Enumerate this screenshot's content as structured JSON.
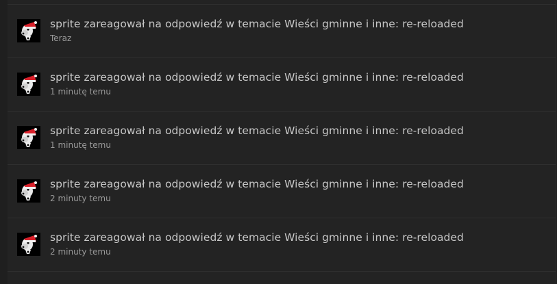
{
  "notifications": [
    {
      "user": "sprite",
      "text": "sprite zareagował na odpowiedź w temacie Wieści gminne i inne: re-reloaded",
      "time": "Teraz",
      "avatar_icon": "santa-hat-dog-avatar"
    },
    {
      "user": "sprite",
      "text": "sprite zareagował na odpowiedź w temacie Wieści gminne i inne: re-reloaded",
      "time": "1 minutę temu",
      "avatar_icon": "santa-hat-dog-avatar"
    },
    {
      "user": "sprite",
      "text": "sprite zareagował na odpowiedź w temacie Wieści gminne i inne: re-reloaded",
      "time": "1 minutę temu",
      "avatar_icon": "santa-hat-dog-avatar"
    },
    {
      "user": "sprite",
      "text": "sprite zareagował na odpowiedź w temacie Wieści gminne i inne: re-reloaded",
      "time": "2 minuty temu",
      "avatar_icon": "santa-hat-dog-avatar"
    },
    {
      "user": "sprite",
      "text": "sprite zareagował na odpowiedź w temacie Wieści gminne i inne: re-reloaded",
      "time": "2 minuty temu",
      "avatar_icon": "santa-hat-dog-avatar"
    }
  ],
  "colors": {
    "background": "#1f1f1f",
    "panel": "#232323",
    "divider": "#2f2f2f",
    "title_text": "#c7c7c7",
    "time_text": "#9a9a9a",
    "hat_red": "#d8202a"
  }
}
